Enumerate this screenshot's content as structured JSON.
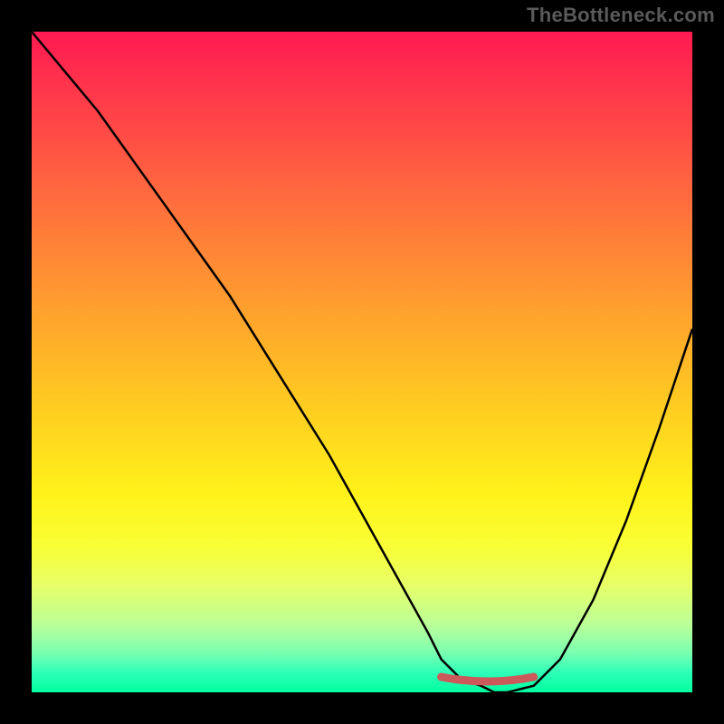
{
  "watermark": "TheBottleneck.com",
  "chart_data": {
    "type": "line",
    "title": "",
    "xlabel": "",
    "ylabel": "",
    "xlim": [
      0,
      100
    ],
    "ylim": [
      0,
      100
    ],
    "x": [
      0,
      5,
      10,
      15,
      20,
      25,
      30,
      35,
      40,
      45,
      50,
      55,
      60,
      62,
      65,
      68,
      70,
      72,
      76,
      80,
      85,
      90,
      95,
      100
    ],
    "values": [
      100,
      94,
      88,
      81,
      74,
      67,
      60,
      52,
      44,
      36,
      27,
      18,
      9,
      5,
      2,
      1,
      0,
      0,
      1,
      5,
      14,
      26,
      40,
      55
    ],
    "optimal_range_x": [
      62,
      76
    ],
    "optimal_y": 1.5,
    "colors": {
      "curve": "#000000",
      "optimal_marker": "#cc5a5a",
      "gradient_top": "#ff1a52",
      "gradient_bottom": "#00ff9f"
    }
  }
}
